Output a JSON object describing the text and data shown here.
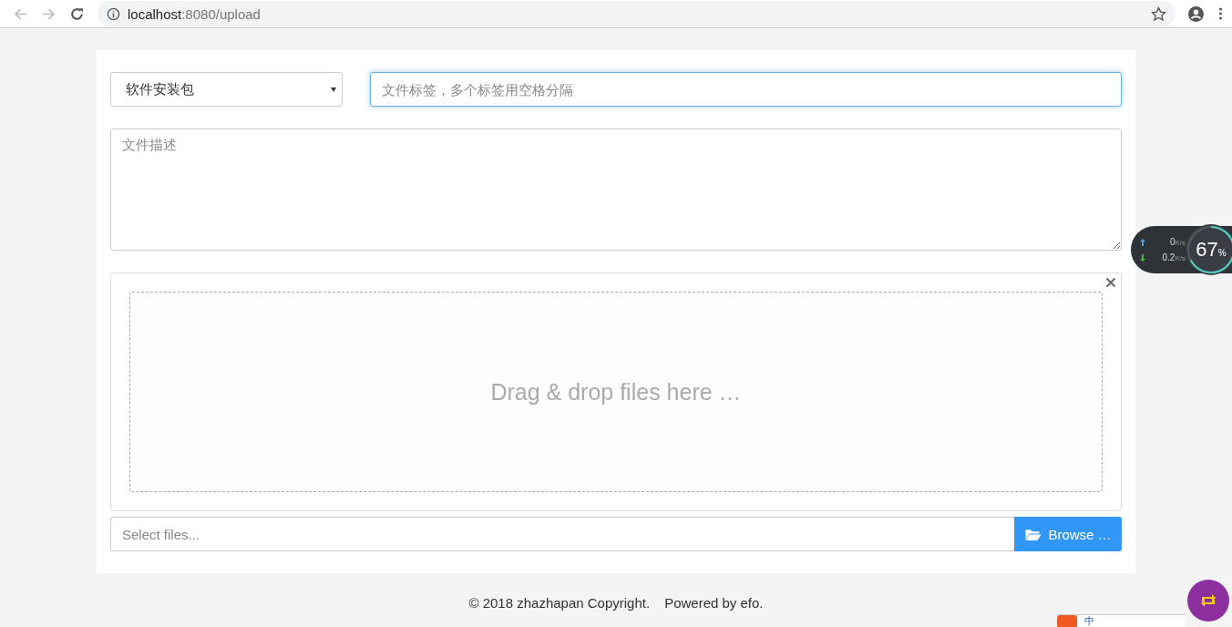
{
  "browser": {
    "url_host": "localhost",
    "url_rest": ":8080/upload"
  },
  "form": {
    "category": "软件安装包",
    "tags_placeholder": "文件标签，多个标签用空格分隔",
    "description_placeholder": "文件描述",
    "drop_text": "Drag & drop files here …",
    "file_placeholder": "Select files...",
    "browse_label": "Browse …"
  },
  "footer": {
    "copyright": "© 2018 zhazhapan Copyright.",
    "powered": "Powered by efo."
  },
  "speed_widget": {
    "upload": "0",
    "upload_unit": "K/s",
    "download": "0.2",
    "download_unit": "K/s",
    "percent": "67",
    "percent_sign": "%",
    "level": 0.67
  },
  "ime_bar": {
    "mode": "中"
  }
}
